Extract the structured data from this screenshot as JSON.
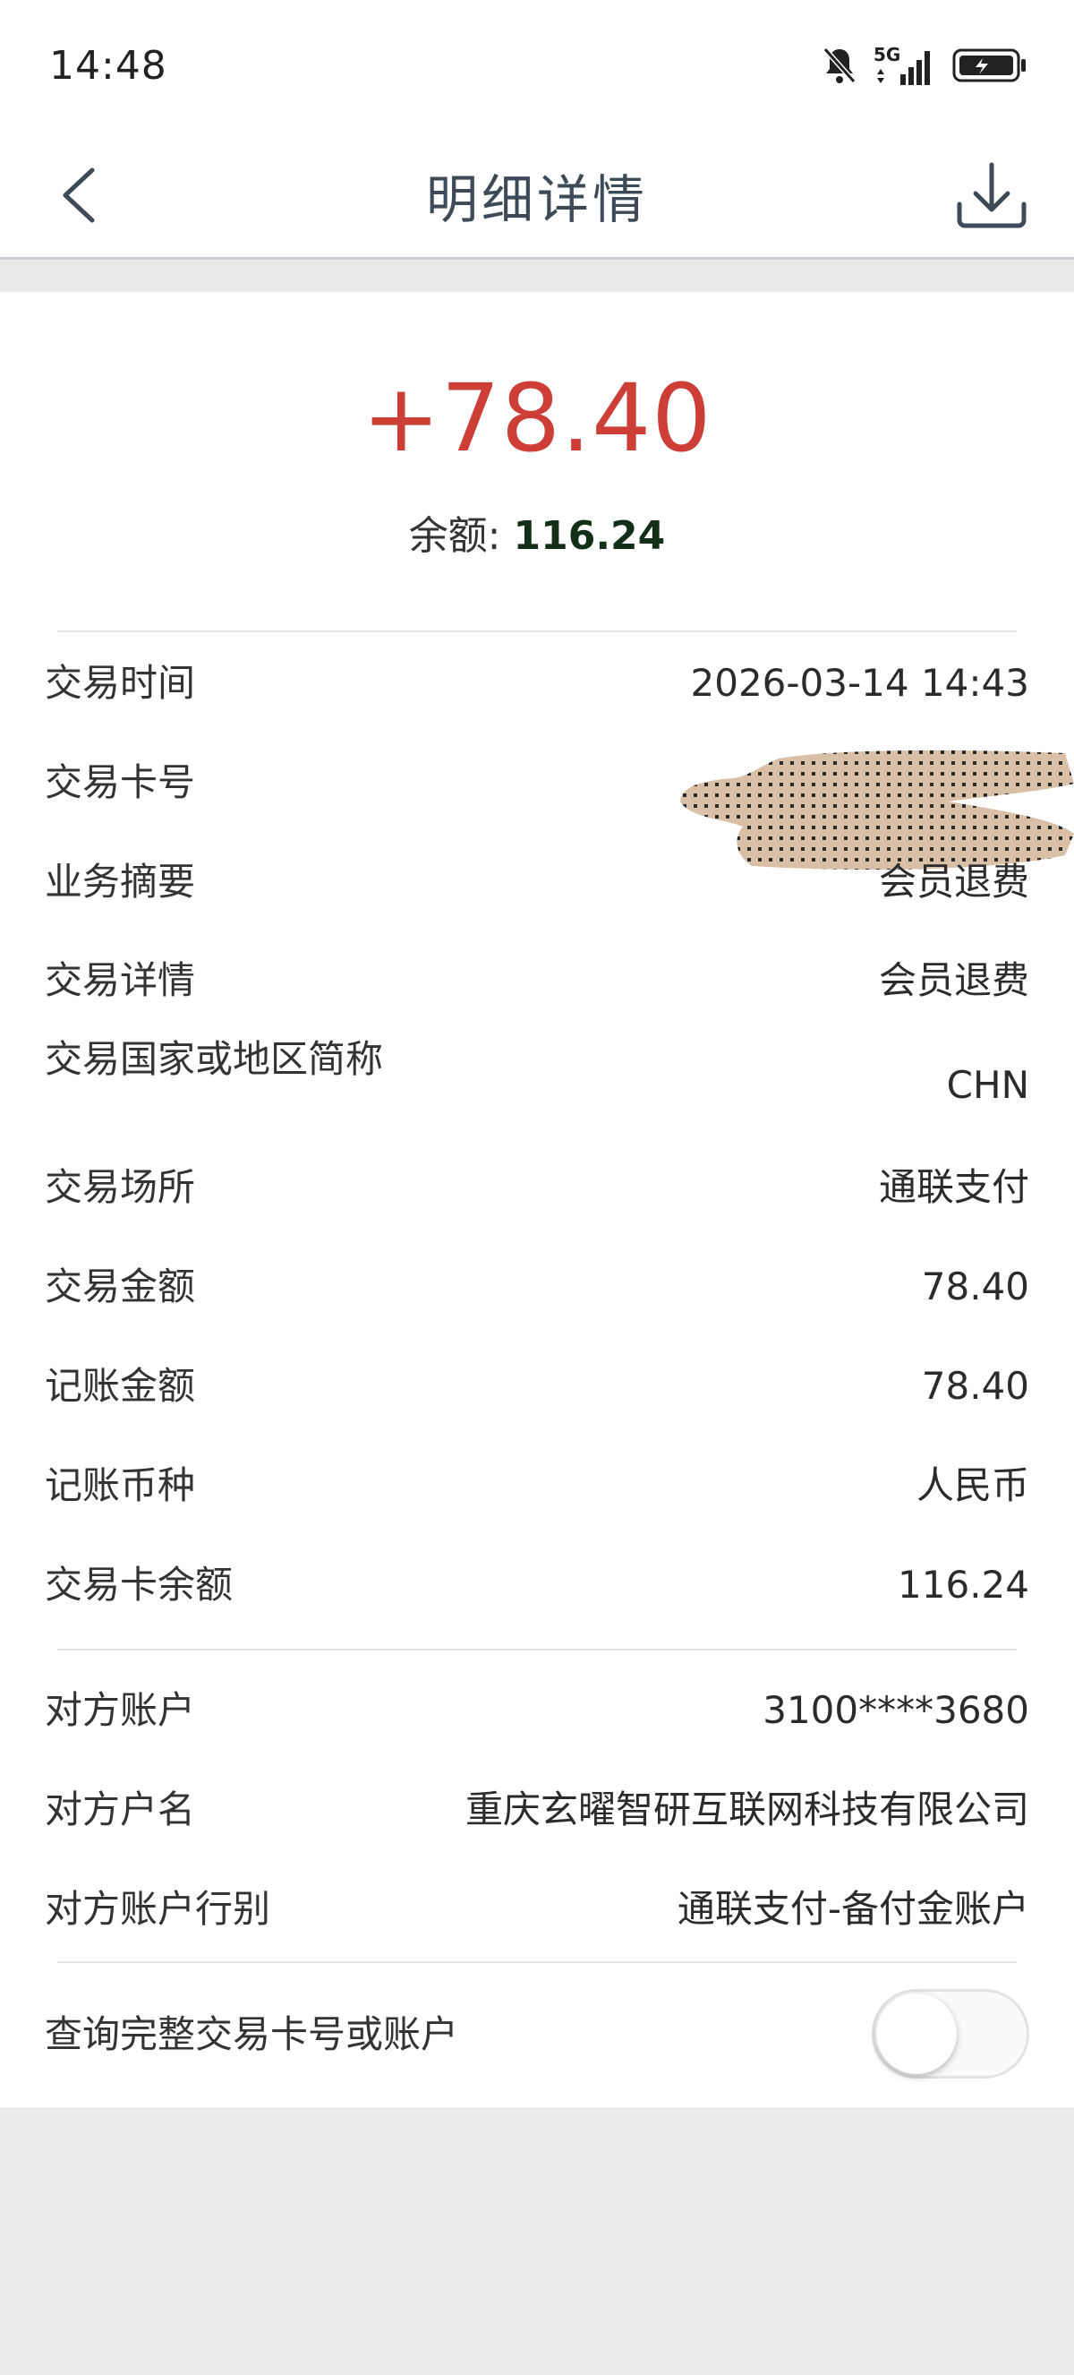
{
  "status_bar": {
    "time": "14:48",
    "icons": [
      "mute-bell-icon",
      "5g-signal-icon",
      "battery-charging-icon"
    ],
    "network_label": "5G"
  },
  "nav": {
    "title": "明细详情",
    "back_icon": "back-chevron-icon",
    "download_icon": "download-icon"
  },
  "summary": {
    "amount": "+78.40",
    "balance_label": "余额: ",
    "balance_value": "116.24",
    "amount_color": "#cc3e36"
  },
  "details": [
    {
      "label": "交易时间",
      "value": "2026-03-14 14:43"
    },
    {
      "label": "交易卡号",
      "value": ""
    },
    {
      "label": "业务摘要",
      "value": "会员退费"
    },
    {
      "label": "交易详情",
      "value": "会员退费"
    },
    {
      "label": "交易国家或地区简称",
      "value": "CHN"
    },
    {
      "label": "交易场所",
      "value": "通联支付"
    },
    {
      "label": "交易金额",
      "value": "78.40"
    },
    {
      "label": "记账金额",
      "value": "78.40"
    },
    {
      "label": "记账币种",
      "value": "人民币"
    },
    {
      "label": "交易卡余额",
      "value": "116.24"
    }
  ],
  "counterparty": [
    {
      "label": "对方账户",
      "value": "3100****3680"
    },
    {
      "label": "对方户名",
      "value": "重庆玄曜智研互联网科技有限公司"
    },
    {
      "label": "对方账户行别",
      "value": "通联支付-备付金账户"
    }
  ],
  "query_full": {
    "label": "查询完整交易卡号或账户",
    "toggle_on": false
  }
}
